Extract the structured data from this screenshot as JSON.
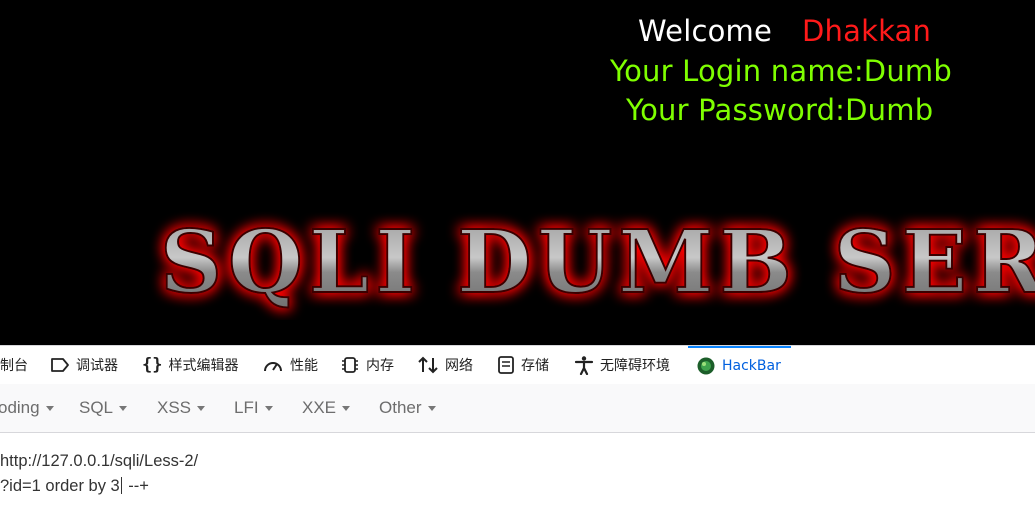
{
  "page": {
    "welcome_label": "Welcome",
    "welcome_name": "Dhakkan",
    "login_line": "Your Login name:Dumb",
    "password_line": "Your Password:Dumb",
    "banner_text": "SQLI DUMB SERIES",
    "colors": {
      "welcome": "#ffffff",
      "name": "#ff1a1a",
      "info": "#7fff00",
      "background": "#000000"
    }
  },
  "devtools": {
    "tabs": [
      {
        "label": "制台",
        "icon": "console-icon"
      },
      {
        "label": "调试器",
        "icon": "debugger-icon"
      },
      {
        "label": "样式编辑器",
        "icon": "style-editor-icon"
      },
      {
        "label": "性能",
        "icon": "performance-icon"
      },
      {
        "label": "内存",
        "icon": "memory-icon"
      },
      {
        "label": "网络",
        "icon": "network-icon"
      },
      {
        "label": "存储",
        "icon": "storage-icon"
      },
      {
        "label": "无障碍环境",
        "icon": "accessibility-icon"
      },
      {
        "label": "HackBar",
        "icon": "hackbar-icon",
        "active": true
      }
    ]
  },
  "hackbar": {
    "menu": [
      "oding",
      "SQL",
      "XSS",
      "LFI",
      "XXE",
      "Other"
    ],
    "url_line1": "http://127.0.0.1/sqli/Less-2/",
    "url_line2_before_cursor": "?id=1 order by 3",
    "url_line2_after_cursor": " --+"
  }
}
